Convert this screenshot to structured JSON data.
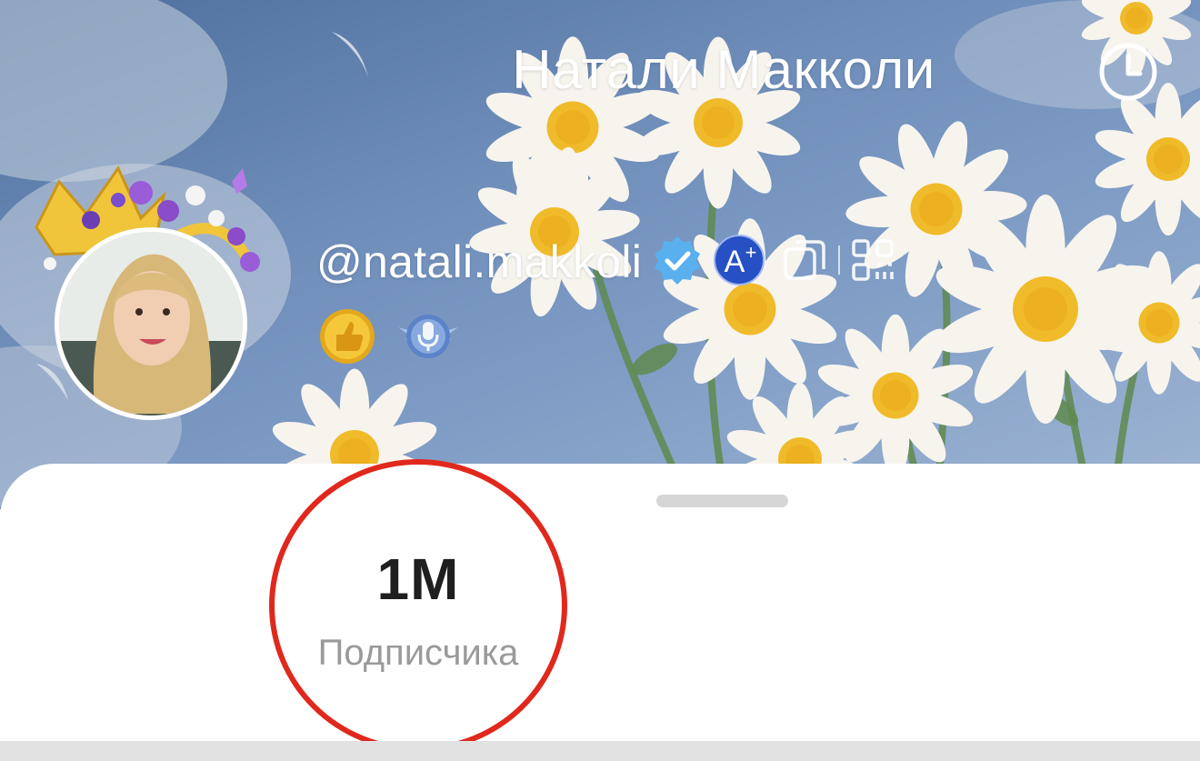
{
  "header": {
    "title": "Натали Макколи"
  },
  "profile": {
    "username": "@natali.makkoli",
    "badges": [
      "verified-badge-icon",
      "a-plus-badge-icon"
    ],
    "achievements": [
      "thumbs-up-medal-icon",
      "microphone-medal-icon"
    ]
  },
  "stats": {
    "followers_value": "1M",
    "followers_label": "Подписчика"
  },
  "colors": {
    "annotation_circle": "#e0281c",
    "verified": "#5ab0ee",
    "a_plus": "#2750c4"
  }
}
